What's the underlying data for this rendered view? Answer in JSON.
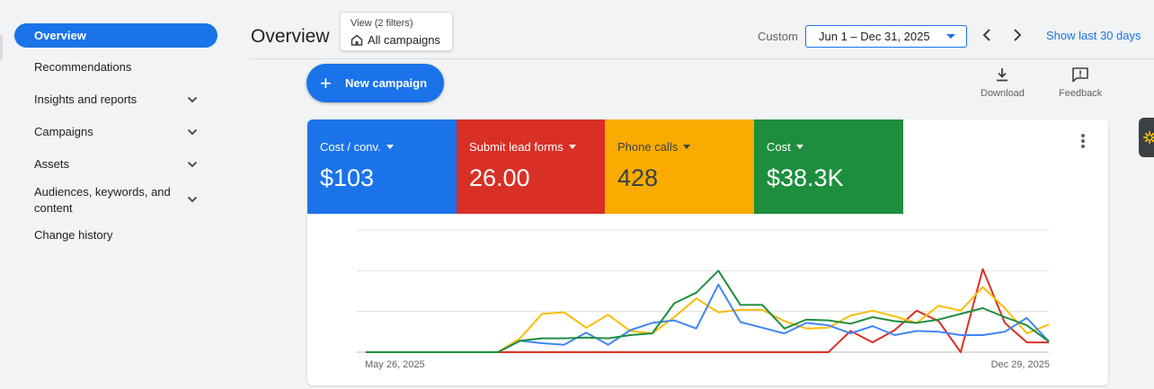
{
  "sidebar": {
    "items": [
      {
        "label": "Overview"
      },
      {
        "label": "Recommendations"
      },
      {
        "label": "Insights and reports"
      },
      {
        "label": "Campaigns"
      },
      {
        "label": "Assets"
      },
      {
        "label": "Audiences, keywords, and content"
      },
      {
        "label": "Change history"
      }
    ]
  },
  "header": {
    "title": "Overview",
    "filter_view": "View (2 filters)",
    "filter_scope": "All campaigns",
    "date_mode": "Custom",
    "date_range": "Jun 1 – Dec 31, 2025",
    "show_last": "Show last 30 days"
  },
  "toolbar": {
    "new_campaign": "New campaign",
    "download": "Download",
    "feedback": "Feedback"
  },
  "metrics": [
    {
      "label": "Cost / conv.",
      "value": "$103",
      "color": "#1a73e8"
    },
    {
      "label": "Submit lead forms",
      "value": "26.00",
      "color": "#d93025"
    },
    {
      "label": "Phone calls",
      "value": "428",
      "color": "#f9ab00"
    },
    {
      "label": "Cost",
      "value": "$38.3K",
      "color": "#1e8e3e"
    }
  ],
  "chart_data": {
    "type": "line",
    "x_start_label": "May 26, 2025",
    "x_end_label": "Dec 29, 2025",
    "grid": true,
    "ylim": [
      0,
      3
    ],
    "series": [
      {
        "name": "Cost / conv.",
        "color": "#4285f4",
        "values": [
          0,
          0,
          0,
          0,
          0,
          0,
          0,
          0.28,
          0.22,
          0.18,
          0.48,
          0.18,
          0.54,
          0.72,
          0.78,
          0.58,
          1.66,
          0.74,
          0.6,
          0.46,
          0.72,
          0.66,
          0.46,
          0.64,
          0.42,
          0.52,
          0.5,
          0.42,
          0.42,
          0.5,
          0.84,
          0.26
        ]
      },
      {
        "name": "Submit lead forms",
        "color": "#d93025",
        "values": [
          0,
          0,
          0,
          0,
          0,
          0,
          0,
          0,
          0,
          0,
          0,
          0,
          0,
          0,
          0,
          0,
          0,
          0,
          0,
          0,
          0,
          0,
          0.52,
          0.24,
          0.54,
          1.02,
          0.76,
          0,
          2.04,
          0.72,
          0.24,
          0.24
        ]
      },
      {
        "name": "Phone calls",
        "color": "#fbbc04",
        "values": [
          0,
          0,
          0,
          0,
          0,
          0,
          0,
          0.34,
          0.94,
          0.98,
          0.6,
          0.92,
          0.52,
          0.46,
          0.86,
          1.32,
          0.98,
          1.04,
          1.04,
          0.76,
          0.58,
          0.6,
          0.9,
          1.02,
          0.88,
          0.72,
          1.14,
          1.02,
          1.6,
          1.08,
          0.46,
          0.68
        ]
      },
      {
        "name": "Cost",
        "color": "#1e8e3e",
        "values": [
          0,
          0,
          0,
          0,
          0,
          0,
          0,
          0.28,
          0.34,
          0.34,
          0.36,
          0.34,
          0.42,
          0.46,
          1.2,
          1.46,
          2.0,
          1.16,
          1.16,
          0.58,
          0.8,
          0.78,
          0.7,
          0.86,
          0.76,
          0.72,
          0.8,
          0.94,
          1.08,
          0.86,
          0.66,
          0.26
        ]
      }
    ]
  }
}
